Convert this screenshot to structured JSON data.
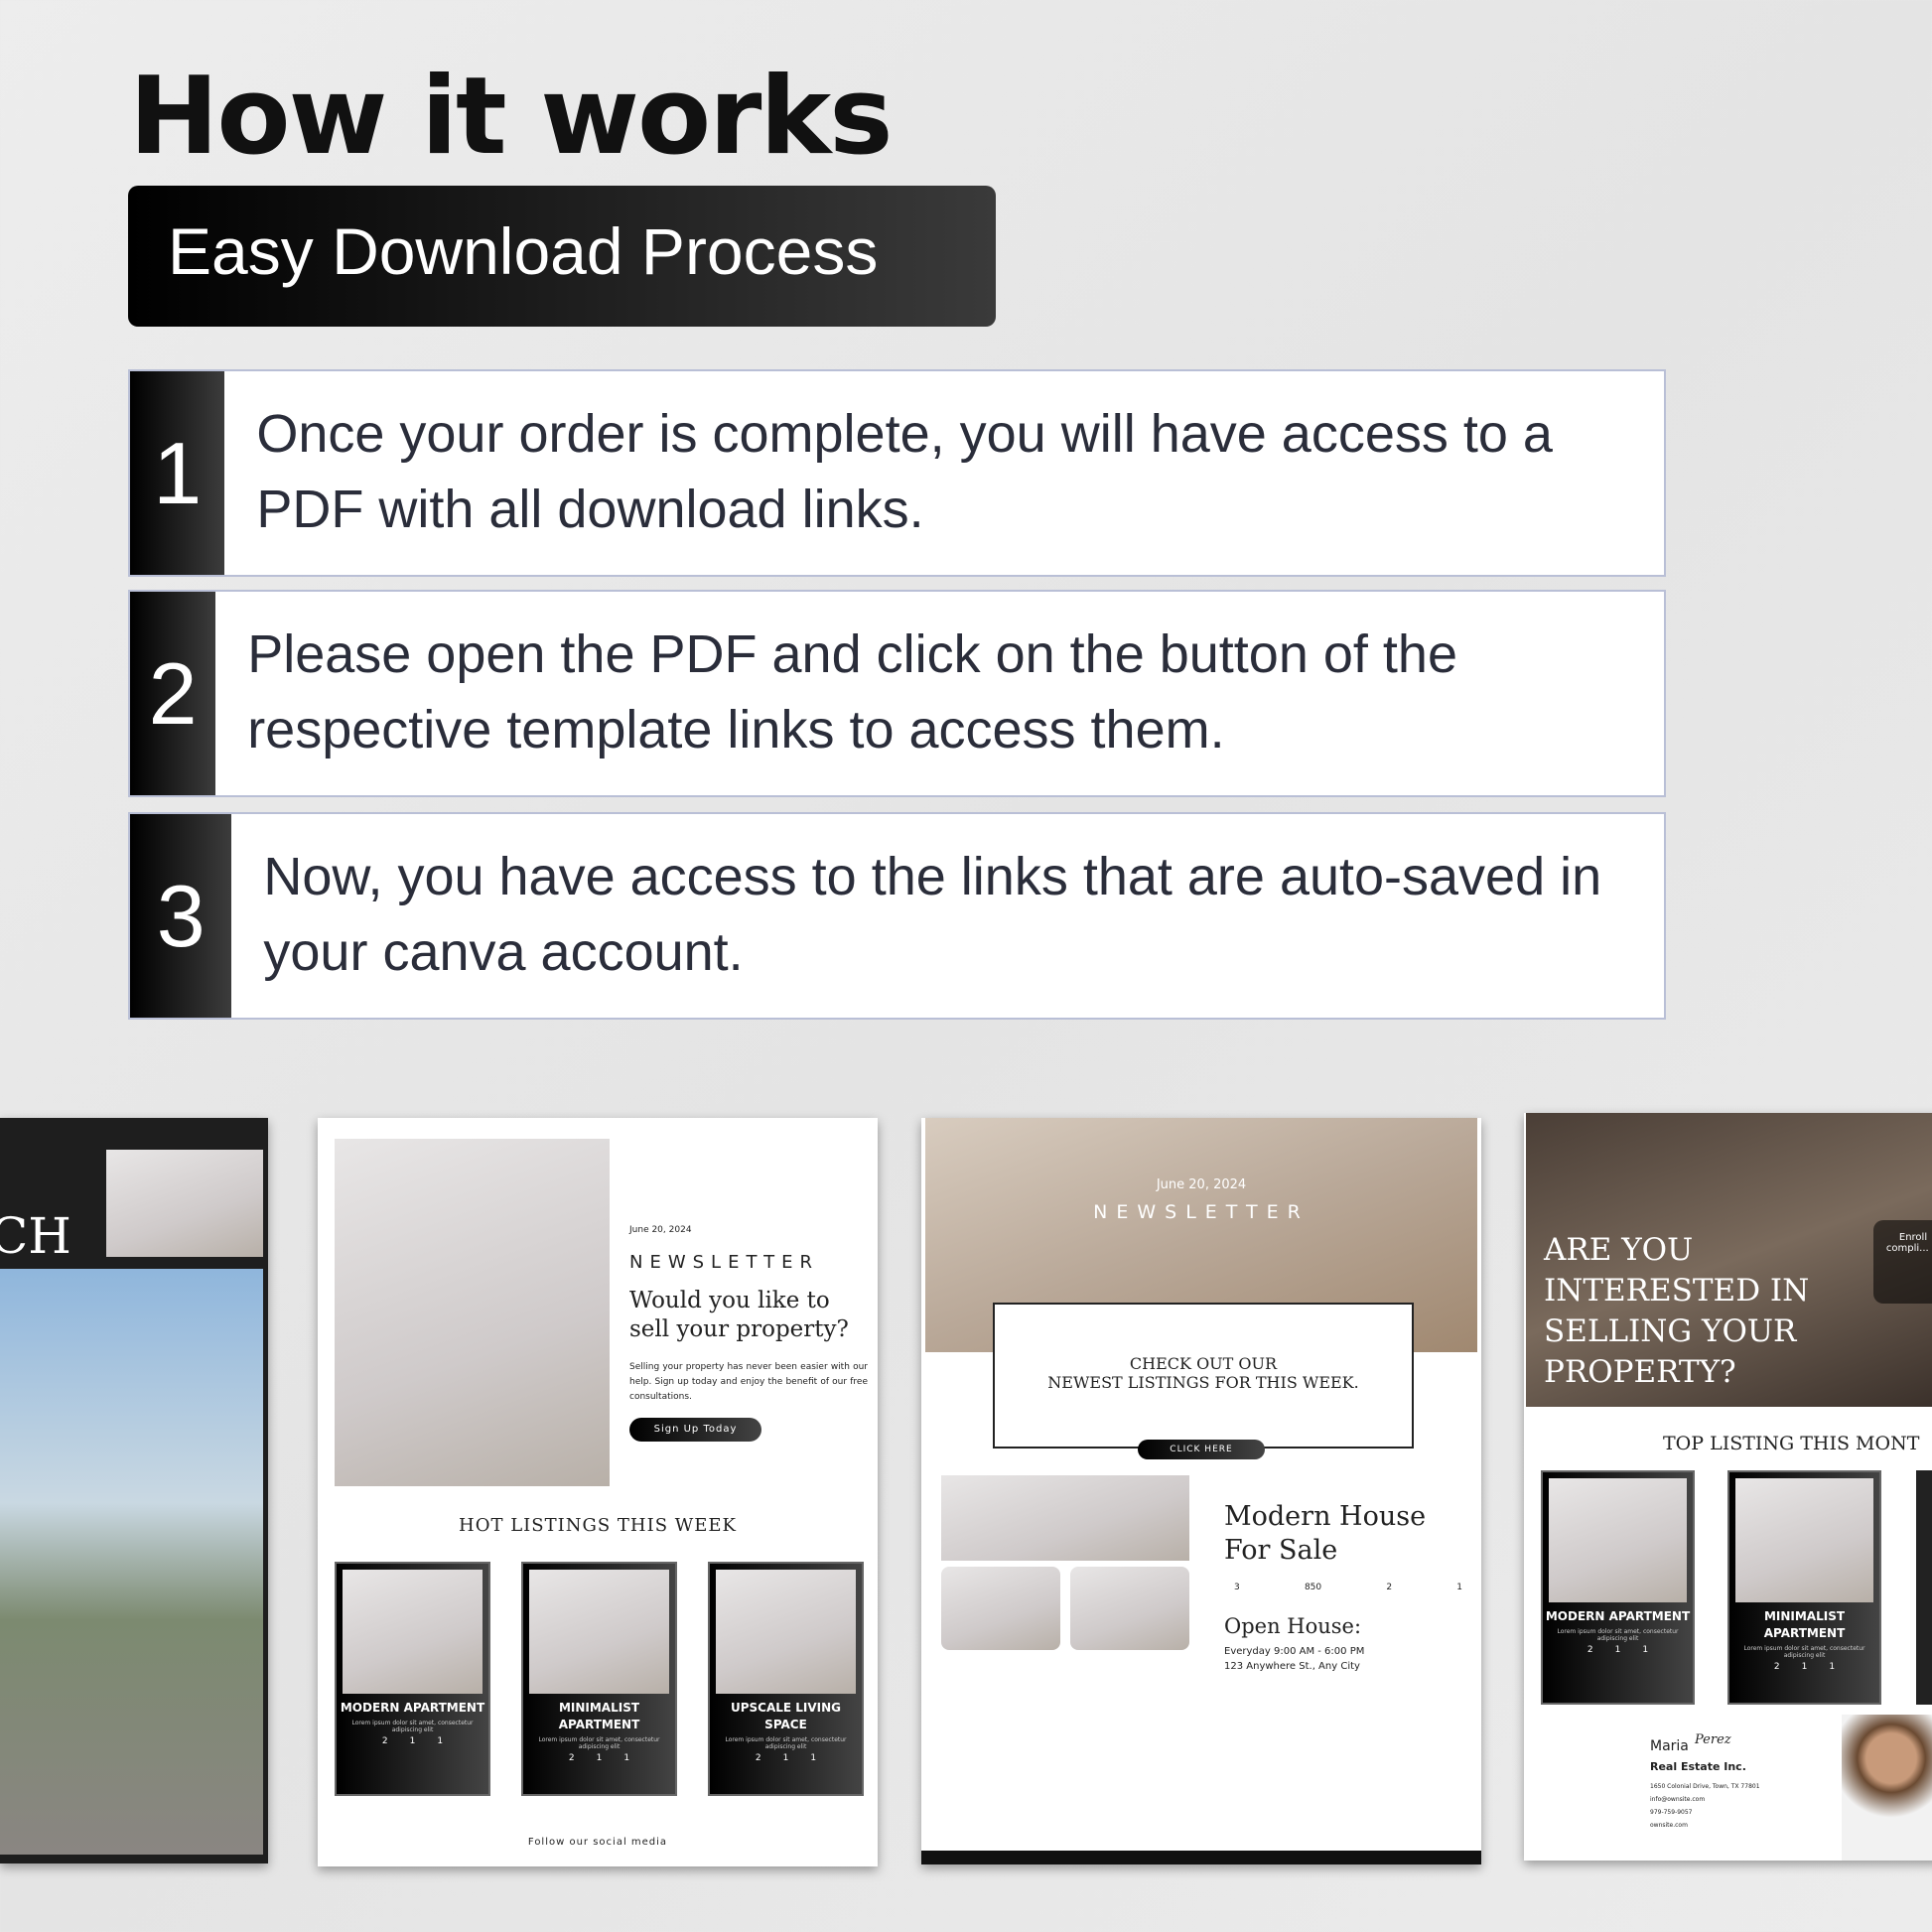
{
  "header": {
    "title": "How it works",
    "subtitle": "Easy Download Process"
  },
  "steps": [
    {
      "number": "1",
      "text": "Once your order is complete, you will have access to a PDF with all download links."
    },
    {
      "number": "2",
      "text": "Please open the PDF and click on the button of the respective template links to access them."
    },
    {
      "number": "3",
      "text": "Now, you have access to the links that are auto-saved in your canva account."
    }
  ],
  "preview_left": {
    "heading_fragment": "CH"
  },
  "preview1": {
    "date": "June 20, 2024",
    "label": "NEWSLETTER",
    "headline": "Would you like to sell your property?",
    "body": "Selling your property has never been easier with our help. Sign up today and enjoy the benefit of our free consultations.",
    "button": "Sign Up Today",
    "section": "HOT LISTINGS THIS WEEK",
    "cards": [
      {
        "title": "MODERN APARTMENT",
        "desc": "Lorem ipsum dolor sit amet, consectetur adipiscing elit",
        "beds": "2",
        "baths": "1",
        "cars": "1"
      },
      {
        "title": "MINIMALIST APARTMENT",
        "desc": "Lorem ipsum dolor sit amet, consectetur adipiscing elit",
        "beds": "2",
        "baths": "1",
        "cars": "1"
      },
      {
        "title": "UPSCALE LIVING SPACE",
        "desc": "Lorem ipsum dolor sit amet, consectetur adipiscing elit",
        "beds": "2",
        "baths": "1",
        "cars": "1"
      }
    ],
    "footer": "Follow our social media"
  },
  "preview2": {
    "date": "June 20, 2024",
    "label": "NEWSLETTER",
    "box_line1": "CHECK OUT OUR",
    "box_line2": "NEWEST LISTINGS FOR THIS WEEK.",
    "button": "CLICK HERE",
    "headline": "Modern House For Sale",
    "beds": "3",
    "area": "850",
    "baths": "2",
    "cars": "1",
    "open_house": "Open House:",
    "hours": "Everyday 9:00 AM - 6:00 PM",
    "address": "123 Anywhere St., Any City"
  },
  "preview3": {
    "headline": "ARE YOU INTERESTED IN SELLING YOUR PROPERTY?",
    "overlay_text": "Enroll compli... w",
    "section": "TOP LISTING THIS MONT",
    "cards": [
      {
        "title": "MODERN APARTMENT",
        "desc": "Lorem ipsum dolor sit amet, consectetur adipiscing elit",
        "beds": "2",
        "baths": "1",
        "cars": "1"
      },
      {
        "title": "MINIMALIST APARTMENT",
        "desc": "Lorem ipsum dolor sit amet, consectetur adipiscing elit",
        "beds": "2",
        "baths": "1",
        "cars": "1"
      }
    ],
    "agent": {
      "name": "Maria",
      "signature": "Perez",
      "company": "Real Estate Inc.",
      "address": "1650 Colonial Drive, Town, TX 77801",
      "email": "info@ownsite.com",
      "phone": "979-759-9057",
      "website": "ownsite.com"
    }
  }
}
